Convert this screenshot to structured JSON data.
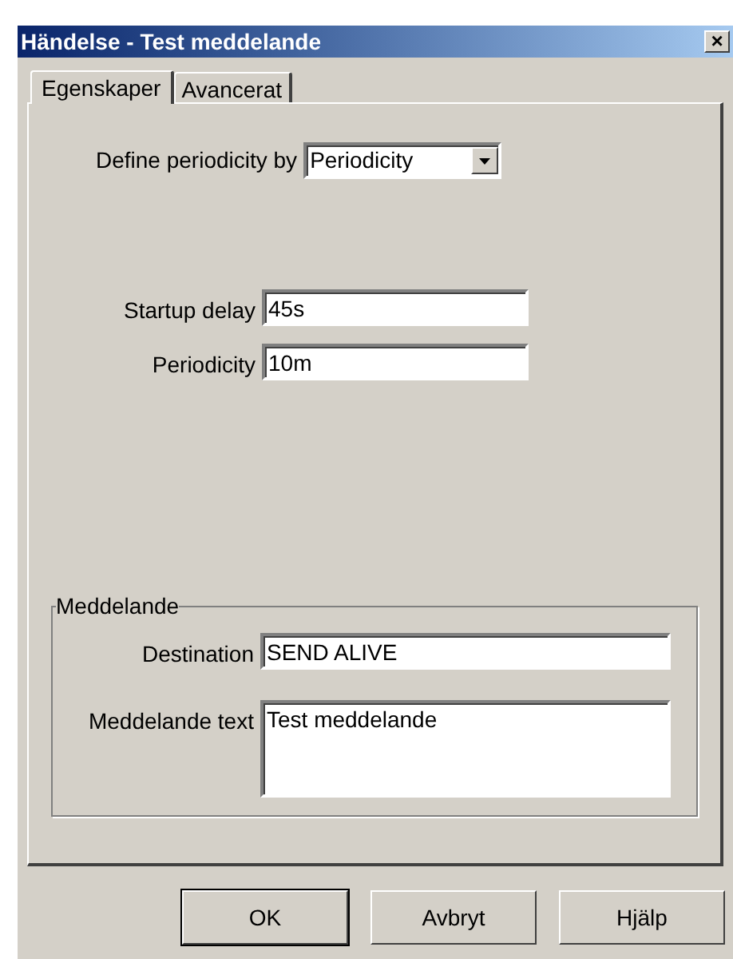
{
  "window": {
    "title": "Händelse - Test meddelande",
    "close": "×"
  },
  "tabs": [
    {
      "label": "Egenskaper",
      "selected": true
    },
    {
      "label": "Avancerat",
      "selected": false
    }
  ],
  "define_periodicity": {
    "label": "Define periodicity by",
    "value": "Periodicity"
  },
  "startup_delay": {
    "label": "Startup delay",
    "value": "45s"
  },
  "periodicity": {
    "label": "Periodicity",
    "value": "10m"
  },
  "message_group": {
    "title": "Meddelande",
    "destination": {
      "label": "Destination",
      "value": "SEND ALIVE"
    },
    "text": {
      "label": "Meddelande text",
      "value": "Test meddelande"
    }
  },
  "buttons": [
    {
      "label": "OK",
      "default": true
    },
    {
      "label": "Avbryt",
      "default": false
    },
    {
      "label": "Hjälp",
      "default": false
    }
  ]
}
